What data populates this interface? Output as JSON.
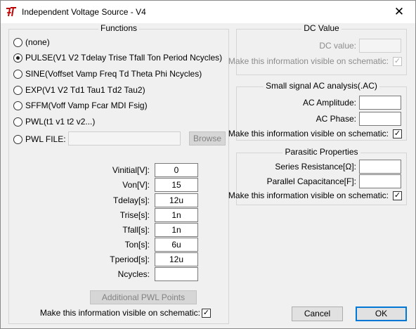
{
  "window": {
    "title": "Independent Voltage Source - V4",
    "close_glyph": "✕",
    "app_icon": "ltspice-icon"
  },
  "functions": {
    "title": "Functions",
    "options": [
      {
        "label": "(none)",
        "checked": false
      },
      {
        "label": "PULSE(V1 V2 Tdelay Trise Tfall Ton Period Ncycles)",
        "checked": true
      },
      {
        "label": "SINE(Voffset Vamp Freq Td Theta Phi Ncycles)",
        "checked": false
      },
      {
        "label": "EXP(V1 V2 Td1 Tau1 Td2 Tau2)",
        "checked": false
      },
      {
        "label": "SFFM(Voff Vamp Fcar MDI Fsig)",
        "checked": false
      },
      {
        "label": "PWL(t1 v1 t2 v2...)",
        "checked": false
      },
      {
        "label": "PWL FILE:",
        "checked": false
      }
    ],
    "pwl_file_value": "",
    "browse_label": "Browse",
    "params": [
      {
        "label": "Vinitial[V]:",
        "value": "0"
      },
      {
        "label": "Von[V]:",
        "value": "15"
      },
      {
        "label": "Tdelay[s]:",
        "value": "12u"
      },
      {
        "label": "Trise[s]:",
        "value": "1n"
      },
      {
        "label": "Tfall[s]:",
        "value": "1n"
      },
      {
        "label": "Ton[s]:",
        "value": "6u"
      },
      {
        "label": "Tperiod[s]:",
        "value": "12u"
      },
      {
        "label": "Ncycles:",
        "value": ""
      }
    ],
    "pwl_points_label": "Additional PWL Points",
    "visible_label": "Make this information visible on schematic:",
    "visible_checked": true
  },
  "dc": {
    "title": "DC Value",
    "value_label": "DC value:",
    "value": "",
    "visible_label": "Make this information visible on schematic:",
    "visible_checked": true
  },
  "ac": {
    "title": "Small signal AC analysis(.AC)",
    "amplitude_label": "AC Amplitude:",
    "amplitude_value": "",
    "phase_label": "AC Phase:",
    "phase_value": "",
    "visible_label": "Make this information visible on schematic:",
    "visible_checked": true
  },
  "parasitic": {
    "title": "Parasitic Properties",
    "series_label": "Series Resistance[Ω]:",
    "series_value": "",
    "parallel_label": "Parallel Capacitance[F]:",
    "parallel_value": "",
    "visible_label": "Make this information visible on schematic:",
    "visible_checked": true
  },
  "footer": {
    "cancel_label": "Cancel",
    "ok_label": "OK"
  },
  "check_glyph": "✓"
}
